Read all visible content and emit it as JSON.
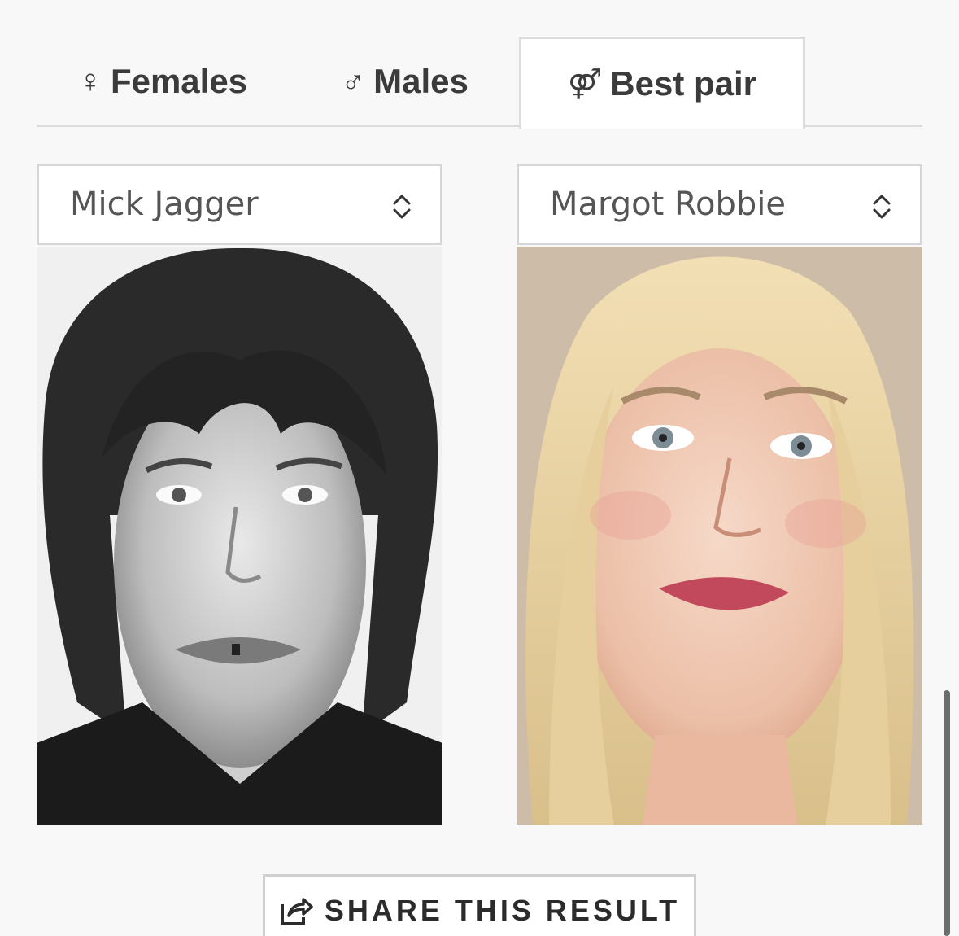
{
  "tabs": [
    {
      "symbol": "♀",
      "icon": "female-symbol-icon",
      "label": "Females",
      "active": false
    },
    {
      "symbol": "♂",
      "icon": "male-symbol-icon",
      "label": "Males",
      "active": false
    },
    {
      "symbol": "⚤",
      "icon": "pair-symbol-icon",
      "label": "Best pair",
      "active": true
    }
  ],
  "selects": {
    "left": {
      "value": "Mick Jagger",
      "icon": "chevron-up-down-icon"
    },
    "right": {
      "value": "Margot Robbie",
      "icon": "chevron-up-down-icon"
    }
  },
  "photos": {
    "left": {
      "style": "black-and-white portrait"
    },
    "right": {
      "style": "color portrait"
    }
  },
  "share": {
    "label": "SHARE THIS RESULT",
    "icon": "share-icon"
  },
  "colors": {
    "page_bg": "#f8f8f8",
    "tab_border": "#dcdcdc",
    "text": "#3b3b3b"
  }
}
